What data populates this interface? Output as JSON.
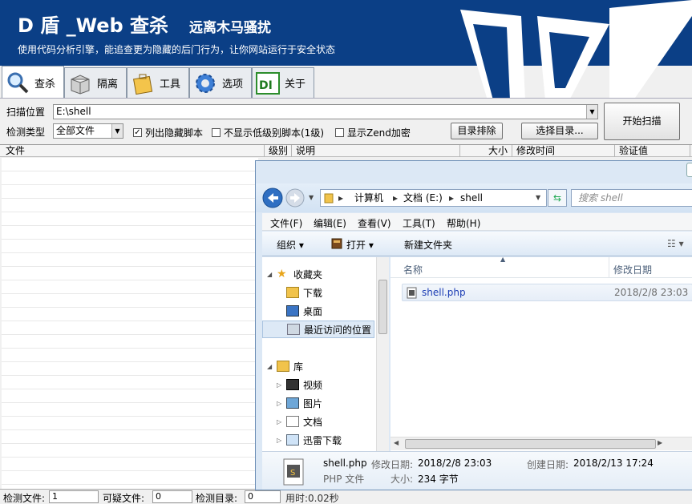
{
  "banner": {
    "title": "D 盾 _Web 查杀",
    "slogan": "远离木马骚扰",
    "subtitle": "使用代码分析引擎，能追查更为隐藏的后门行为，让你网站运行于安全状态"
  },
  "tabs": [
    {
      "label": "查杀",
      "icon": "magnifier-icon"
    },
    {
      "label": "隔离",
      "icon": "box-icon"
    },
    {
      "label": "工具",
      "icon": "toolbox-icon"
    },
    {
      "label": "选项",
      "icon": "gear-icon"
    },
    {
      "label": "关于",
      "icon": "d-logo-icon"
    }
  ],
  "scan": {
    "location_label": "扫描位置",
    "location_value": "E:\\shell",
    "type_label": "检测类型",
    "type_value": "全部文件",
    "chk_hidden": "列出隐藏脚本",
    "chk_lowlevel": "不显示低级别脚本(1级)",
    "chk_zend": "显示Zend加密",
    "btn_exclude": "目录排除",
    "btn_choose": "选择目录...",
    "btn_start": "开始扫描"
  },
  "columns": [
    "文件",
    "级别",
    "说明",
    "大小",
    "修改时间",
    "验证值"
  ],
  "status": {
    "files_label": "检测文件:",
    "files_value": "1",
    "suspicious_label": "可疑文件:",
    "suspicious_value": "0",
    "dirs_label": "检测目录:",
    "dirs_value": "0",
    "time_text": "用时:0.02秒"
  },
  "explorer": {
    "breadcrumb": [
      "计算机",
      "文档 (E:)",
      "shell"
    ],
    "search_placeholder": "搜索 shell",
    "menu": [
      "文件(F)",
      "编辑(E)",
      "查看(V)",
      "工具(T)",
      "帮助(H)"
    ],
    "cmd": {
      "organize": "组织 ▾",
      "open": "打开 ▾",
      "new_folder": "新建文件夹"
    },
    "nav": {
      "favorites": "收藏夹",
      "downloads": "下载",
      "desktop": "桌面",
      "recent": "最近访问的位置",
      "libraries": "库",
      "videos": "视频",
      "pictures": "图片",
      "documents": "文档",
      "xunlei": "迅雷下载"
    },
    "col_name": "名称",
    "col_modified": "修改日期",
    "file": {
      "name": "shell.php",
      "modified": "2018/2/8 23:03"
    },
    "details": {
      "name": "shell.php",
      "type": "PHP 文件",
      "mod_label": "修改日期:",
      "mod_value": "2018/2/8 23:03",
      "size_label": "大小:",
      "size_value": "234 字节",
      "created_label": "创建日期:",
      "created_value": "2018/2/13 17:24"
    }
  }
}
